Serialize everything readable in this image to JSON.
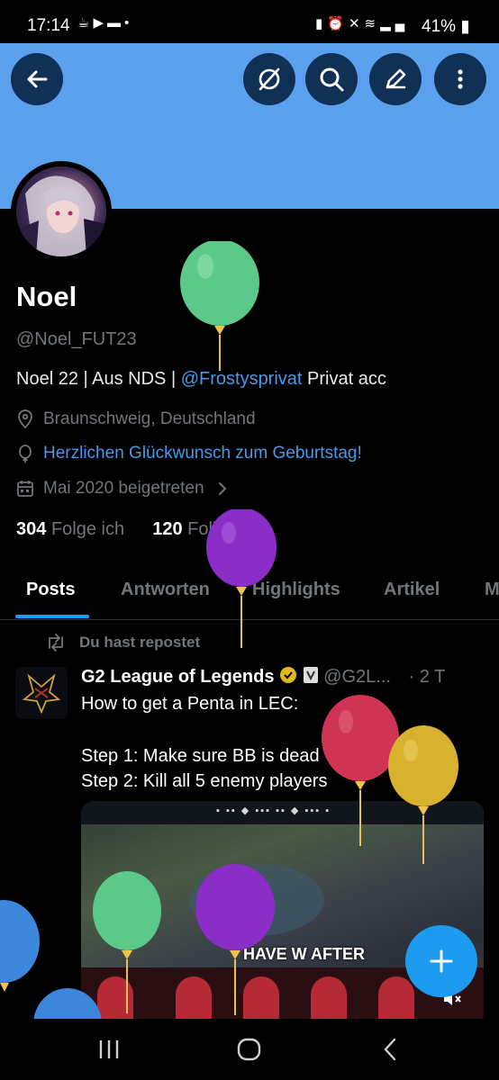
{
  "status_bar": {
    "time": "17:14",
    "battery": "41%",
    "app_icons": [
      "notification-icon",
      "youtube-icon",
      "folder-icon",
      "dot-icon"
    ],
    "system_icons": [
      "battery-saver-icon",
      "alarm-icon",
      "mute-icon",
      "wifi-icon",
      "signal-icon"
    ]
  },
  "header": {
    "buttons": [
      "back-button",
      "grok-button",
      "search-button",
      "edit-button",
      "more-button"
    ],
    "banner_color": "#5aa0ec",
    "button_color": "#103155"
  },
  "profile": {
    "name": "Noel",
    "handle": "@Noel_FUT23",
    "bio_before": "Noel 22 | Aus NDS | ",
    "bio_mention": "@Frostysprivat",
    "bio_after": " Privat acc",
    "location": "Braunschweig, Deutschland",
    "birthday": "Herzlichen Glückwunsch zum Geburtstag!",
    "joined": "Mai 2020 beigetreten",
    "following_count": "304",
    "following_label": "Folge ich",
    "followers_count": "120",
    "followers_label": "Follower"
  },
  "tabs": [
    {
      "label": "Posts",
      "active": true
    },
    {
      "label": "Antworten",
      "active": false
    },
    {
      "label": "Highlights",
      "active": false
    },
    {
      "label": "Artikel",
      "active": false
    },
    {
      "label": "M",
      "active": false
    }
  ],
  "post": {
    "repost_label": "Du hast repostet",
    "author_name": "G2 League of Legends",
    "author_handle": "@G2L...",
    "separator": "·",
    "time": "2 T",
    "lines": [
      "How to get a Penta in LEC:",
      "",
      "Step 1: Make sure BB is dead",
      "Step 2: Kill all 5 enemy players"
    ],
    "media_overlay": "HAVE W AFTER"
  },
  "accent_color": "#1d9bf0",
  "nav_bar": [
    "recents-icon",
    "home-icon",
    "back-nav-icon"
  ]
}
